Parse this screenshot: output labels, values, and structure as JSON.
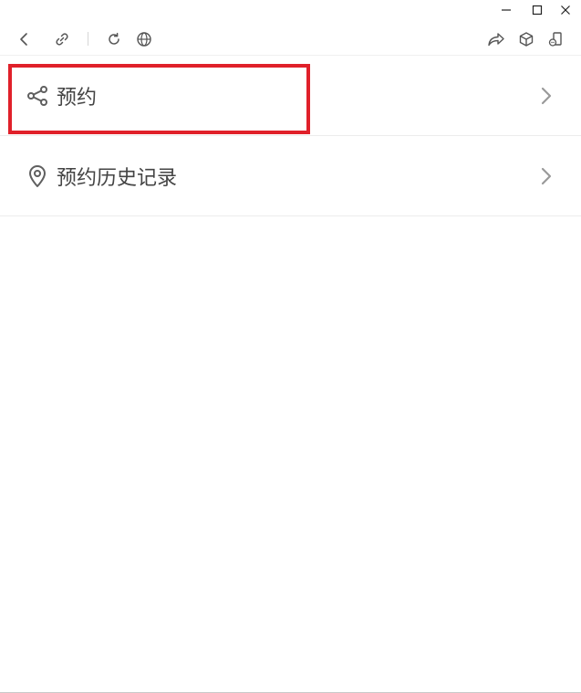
{
  "window_controls": {
    "minimize": "minimize-icon",
    "maximize": "maximize-icon",
    "close": "close-icon"
  },
  "toolbar": {
    "left": [
      "back-icon",
      "link-icon",
      "refresh-icon",
      "globe-icon"
    ],
    "right": [
      "share-forward-icon",
      "cube-icon",
      "mini-program-icon"
    ]
  },
  "menu": {
    "items": [
      {
        "label": "预约",
        "icon": "share-icon"
      },
      {
        "label": "预约历史记录",
        "icon": "location-pin-icon"
      }
    ]
  },
  "colors": {
    "icon": "#5f5f5f",
    "label": "#444444",
    "chevron": "#9a9a9a",
    "highlight": "#e0202a",
    "divider": "#ececec"
  }
}
